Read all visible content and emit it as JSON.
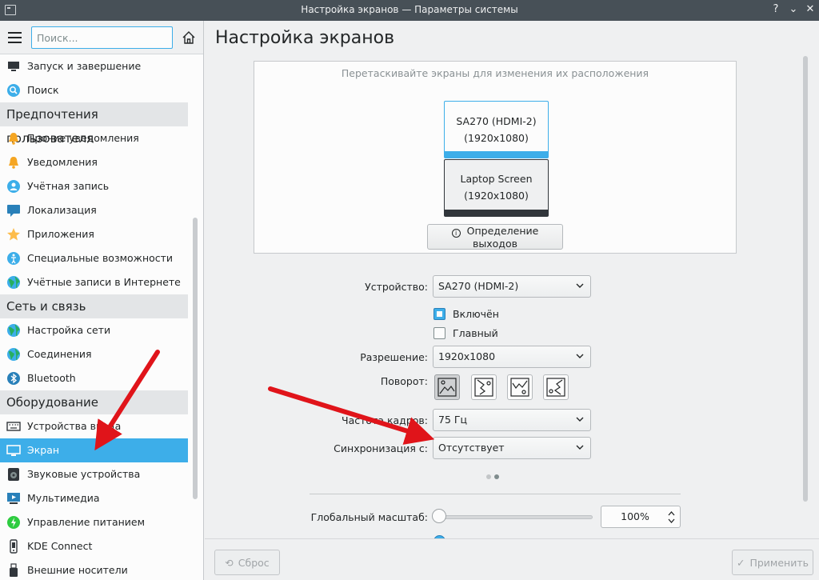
{
  "window": {
    "title": "Настройка экранов — Параметры системы",
    "help_glyph": "?",
    "minimize_glyph": "⌄",
    "close_glyph": "✕"
  },
  "sidebar": {
    "search_placeholder": "Поиск...",
    "rows": [
      {
        "kind": "item",
        "label": "Запуск и завершение",
        "icon": "monitor-icon",
        "color": "#31363b"
      },
      {
        "kind": "item",
        "label": "Поиск",
        "icon": "search-icon",
        "color": "#3daee9"
      },
      {
        "kind": "category",
        "label": "Предпочтения пользователя"
      },
      {
        "kind": "item",
        "label": "Прочие уведомления",
        "icon": "bell-icon",
        "color": "#f5a623"
      },
      {
        "kind": "item",
        "label": "Уведомления",
        "icon": "bell-icon",
        "color": "#f5a623"
      },
      {
        "kind": "item",
        "label": "Учётная запись",
        "icon": "user-icon",
        "color": "#3daee9"
      },
      {
        "kind": "item",
        "label": "Локализация",
        "icon": "chat-icon",
        "color": "#2980b9"
      },
      {
        "kind": "item",
        "label": "Приложения",
        "icon": "star-icon",
        "color": "#fdbc4b"
      },
      {
        "kind": "item",
        "label": "Специальные возможности",
        "icon": "accessibility-icon",
        "color": "#3daee9"
      },
      {
        "kind": "item",
        "label": "Учётные записи в Интернете",
        "icon": "globe-icon",
        "color": "#27ae60"
      },
      {
        "kind": "category",
        "label": "Сеть и связь"
      },
      {
        "kind": "item",
        "label": "Настройка сети",
        "icon": "globe-icon",
        "color": "#27ae60"
      },
      {
        "kind": "item",
        "label": "Соединения",
        "icon": "globe-icon",
        "color": "#27ae60"
      },
      {
        "kind": "item",
        "label": "Bluetooth",
        "icon": "bluetooth-icon",
        "color": "#2980b9"
      },
      {
        "kind": "category",
        "label": "Оборудование"
      },
      {
        "kind": "item",
        "label": "Устройства ввода",
        "icon": "keyboard-icon",
        "color": "#31363b"
      },
      {
        "kind": "item",
        "label": "Экран",
        "icon": "display-icon",
        "color": "#31363b",
        "selected": true
      },
      {
        "kind": "item",
        "label": "Звуковые устройства",
        "icon": "speaker-icon",
        "color": "#31363b"
      },
      {
        "kind": "item",
        "label": "Мультимедиа",
        "icon": "multimedia-icon",
        "color": "#2980b9"
      },
      {
        "kind": "item",
        "label": "Управление питанием",
        "icon": "power-icon",
        "color": "#2ecc40"
      },
      {
        "kind": "item",
        "label": "KDE Connect",
        "icon": "phone-icon",
        "color": "#31363b"
      },
      {
        "kind": "item",
        "label": "Внешние носители",
        "icon": "usb-icon",
        "color": "#31363b"
      }
    ]
  },
  "main": {
    "title": "Настройка экранов",
    "arrange_hint": "Перетаскивайте экраны для изменения их расположения",
    "outputs": [
      {
        "name": "SA270 (HDMI-2)",
        "resolution": "(1920x1080)"
      },
      {
        "name": "Laptop Screen",
        "resolution": "(1920x1080)"
      }
    ],
    "identify_button": "Определение выходов",
    "info_glyph": "i",
    "device_label": "Устройство:",
    "device_value": "SA270 (HDMI-2)",
    "enabled_label": "Включён",
    "enabled_checked": true,
    "primary_label": "Главный",
    "primary_checked": false,
    "resolution_label": "Разрешение:",
    "resolution_value": "1920x1080",
    "rotation_label": "Поворот:",
    "refresh_label": "Частота кадров:",
    "refresh_value": "75 Гц",
    "sync_label": "Синхронизация с:",
    "sync_value": "Отсутствует",
    "scale_label": "Глобальный масштаб:",
    "scale_value": "100%",
    "scale_fraction": 0.0
  },
  "footer": {
    "reset_label": "Сброс",
    "apply_label": "Применить"
  },
  "colors": {
    "accent": "#3daee9",
    "annotation_arrow": "#e0141a"
  }
}
